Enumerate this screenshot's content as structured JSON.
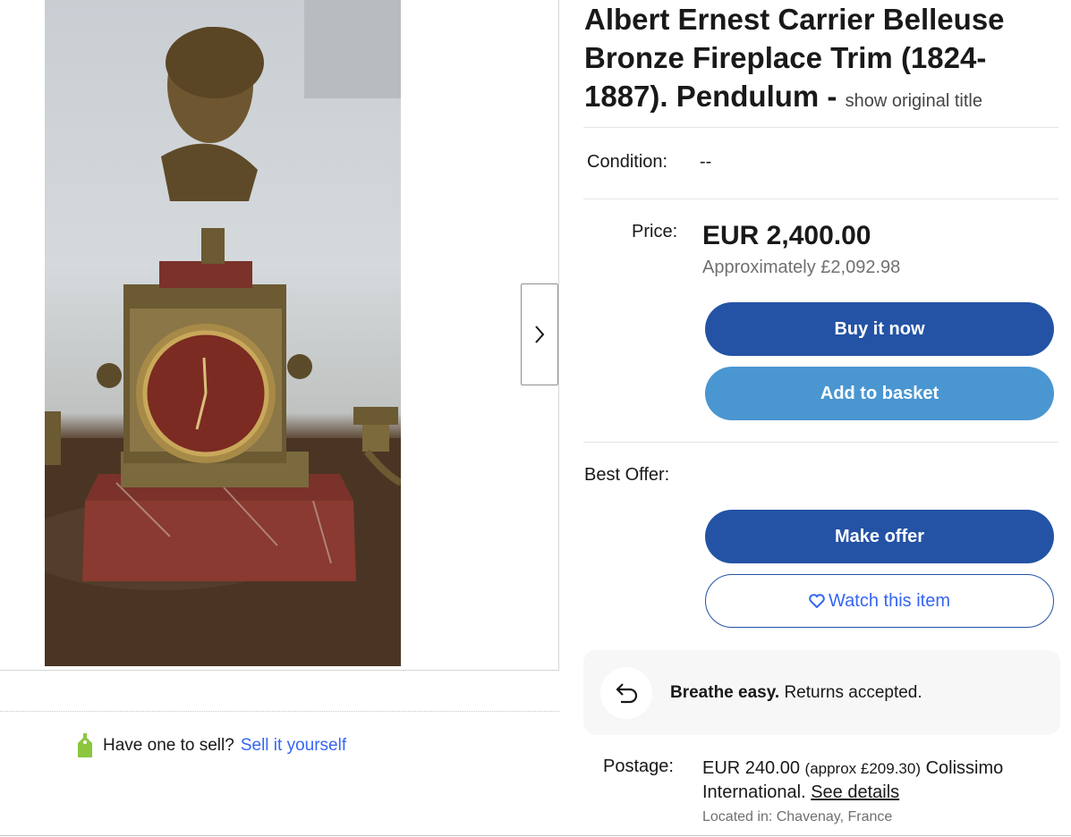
{
  "listing": {
    "title": "Albert Ernest Carrier Belleuse Bronze Fireplace Trim (1824-1887). Pendulum -",
    "show_original": "show original title",
    "condition_label": "Condition:",
    "condition_value": "--",
    "price_label": "Price:",
    "price": "EUR 2,400.00",
    "approx_price": "Approximately £2,092.98",
    "best_offer_label": "Best Offer:"
  },
  "actions": {
    "buy_now": "Buy it now",
    "add_to_basket": "Add to basket",
    "make_offer": "Make offer",
    "watch": "Watch this item"
  },
  "returns": {
    "bold": "Breathe easy.",
    "text": "Returns accepted."
  },
  "postage": {
    "label": "Postage:",
    "price": "EUR 240.00",
    "approx": "(approx £209.30)",
    "service": "Colissimo International.",
    "details_link": "See details",
    "location": "Located in: Chavenay, France"
  },
  "sell": {
    "question": "Have one to sell?",
    "link": "Sell it yourself"
  },
  "icons": {
    "gallery_next": "chevron-right-icon",
    "watch": "heart-icon",
    "returns": "return-arrow-icon",
    "sell": "price-tag-icon"
  },
  "colors": {
    "primary_button": "#2453a5",
    "secondary_button": "#4a96d1",
    "link": "#3665f3",
    "returns_bg": "#f7f7f7",
    "tag_green": "#8cc63f"
  }
}
